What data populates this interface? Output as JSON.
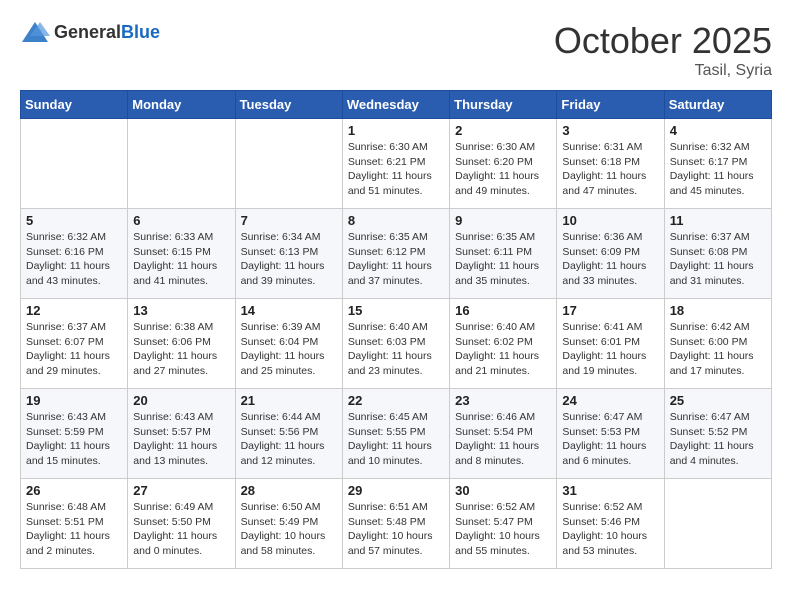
{
  "header": {
    "logo_general": "General",
    "logo_blue": "Blue",
    "month": "October 2025",
    "location": "Tasil, Syria"
  },
  "weekdays": [
    "Sunday",
    "Monday",
    "Tuesday",
    "Wednesday",
    "Thursday",
    "Friday",
    "Saturday"
  ],
  "weeks": [
    [
      {
        "day": "",
        "info": ""
      },
      {
        "day": "",
        "info": ""
      },
      {
        "day": "",
        "info": ""
      },
      {
        "day": "1",
        "info": "Sunrise: 6:30 AM\nSunset: 6:21 PM\nDaylight: 11 hours\nand 51 minutes."
      },
      {
        "day": "2",
        "info": "Sunrise: 6:30 AM\nSunset: 6:20 PM\nDaylight: 11 hours\nand 49 minutes."
      },
      {
        "day": "3",
        "info": "Sunrise: 6:31 AM\nSunset: 6:18 PM\nDaylight: 11 hours\nand 47 minutes."
      },
      {
        "day": "4",
        "info": "Sunrise: 6:32 AM\nSunset: 6:17 PM\nDaylight: 11 hours\nand 45 minutes."
      }
    ],
    [
      {
        "day": "5",
        "info": "Sunrise: 6:32 AM\nSunset: 6:16 PM\nDaylight: 11 hours\nand 43 minutes."
      },
      {
        "day": "6",
        "info": "Sunrise: 6:33 AM\nSunset: 6:15 PM\nDaylight: 11 hours\nand 41 minutes."
      },
      {
        "day": "7",
        "info": "Sunrise: 6:34 AM\nSunset: 6:13 PM\nDaylight: 11 hours\nand 39 minutes."
      },
      {
        "day": "8",
        "info": "Sunrise: 6:35 AM\nSunset: 6:12 PM\nDaylight: 11 hours\nand 37 minutes."
      },
      {
        "day": "9",
        "info": "Sunrise: 6:35 AM\nSunset: 6:11 PM\nDaylight: 11 hours\nand 35 minutes."
      },
      {
        "day": "10",
        "info": "Sunrise: 6:36 AM\nSunset: 6:09 PM\nDaylight: 11 hours\nand 33 minutes."
      },
      {
        "day": "11",
        "info": "Sunrise: 6:37 AM\nSunset: 6:08 PM\nDaylight: 11 hours\nand 31 minutes."
      }
    ],
    [
      {
        "day": "12",
        "info": "Sunrise: 6:37 AM\nSunset: 6:07 PM\nDaylight: 11 hours\nand 29 minutes."
      },
      {
        "day": "13",
        "info": "Sunrise: 6:38 AM\nSunset: 6:06 PM\nDaylight: 11 hours\nand 27 minutes."
      },
      {
        "day": "14",
        "info": "Sunrise: 6:39 AM\nSunset: 6:04 PM\nDaylight: 11 hours\nand 25 minutes."
      },
      {
        "day": "15",
        "info": "Sunrise: 6:40 AM\nSunset: 6:03 PM\nDaylight: 11 hours\nand 23 minutes."
      },
      {
        "day": "16",
        "info": "Sunrise: 6:40 AM\nSunset: 6:02 PM\nDaylight: 11 hours\nand 21 minutes."
      },
      {
        "day": "17",
        "info": "Sunrise: 6:41 AM\nSunset: 6:01 PM\nDaylight: 11 hours\nand 19 minutes."
      },
      {
        "day": "18",
        "info": "Sunrise: 6:42 AM\nSunset: 6:00 PM\nDaylight: 11 hours\nand 17 minutes."
      }
    ],
    [
      {
        "day": "19",
        "info": "Sunrise: 6:43 AM\nSunset: 5:59 PM\nDaylight: 11 hours\nand 15 minutes."
      },
      {
        "day": "20",
        "info": "Sunrise: 6:43 AM\nSunset: 5:57 PM\nDaylight: 11 hours\nand 13 minutes."
      },
      {
        "day": "21",
        "info": "Sunrise: 6:44 AM\nSunset: 5:56 PM\nDaylight: 11 hours\nand 12 minutes."
      },
      {
        "day": "22",
        "info": "Sunrise: 6:45 AM\nSunset: 5:55 PM\nDaylight: 11 hours\nand 10 minutes."
      },
      {
        "day": "23",
        "info": "Sunrise: 6:46 AM\nSunset: 5:54 PM\nDaylight: 11 hours\nand 8 minutes."
      },
      {
        "day": "24",
        "info": "Sunrise: 6:47 AM\nSunset: 5:53 PM\nDaylight: 11 hours\nand 6 minutes."
      },
      {
        "day": "25",
        "info": "Sunrise: 6:47 AM\nSunset: 5:52 PM\nDaylight: 11 hours\nand 4 minutes."
      }
    ],
    [
      {
        "day": "26",
        "info": "Sunrise: 6:48 AM\nSunset: 5:51 PM\nDaylight: 11 hours\nand 2 minutes."
      },
      {
        "day": "27",
        "info": "Sunrise: 6:49 AM\nSunset: 5:50 PM\nDaylight: 11 hours\nand 0 minutes."
      },
      {
        "day": "28",
        "info": "Sunrise: 6:50 AM\nSunset: 5:49 PM\nDaylight: 10 hours\nand 58 minutes."
      },
      {
        "day": "29",
        "info": "Sunrise: 6:51 AM\nSunset: 5:48 PM\nDaylight: 10 hours\nand 57 minutes."
      },
      {
        "day": "30",
        "info": "Sunrise: 6:52 AM\nSunset: 5:47 PM\nDaylight: 10 hours\nand 55 minutes."
      },
      {
        "day": "31",
        "info": "Sunrise: 6:52 AM\nSunset: 5:46 PM\nDaylight: 10 hours\nand 53 minutes."
      },
      {
        "day": "",
        "info": ""
      }
    ]
  ]
}
